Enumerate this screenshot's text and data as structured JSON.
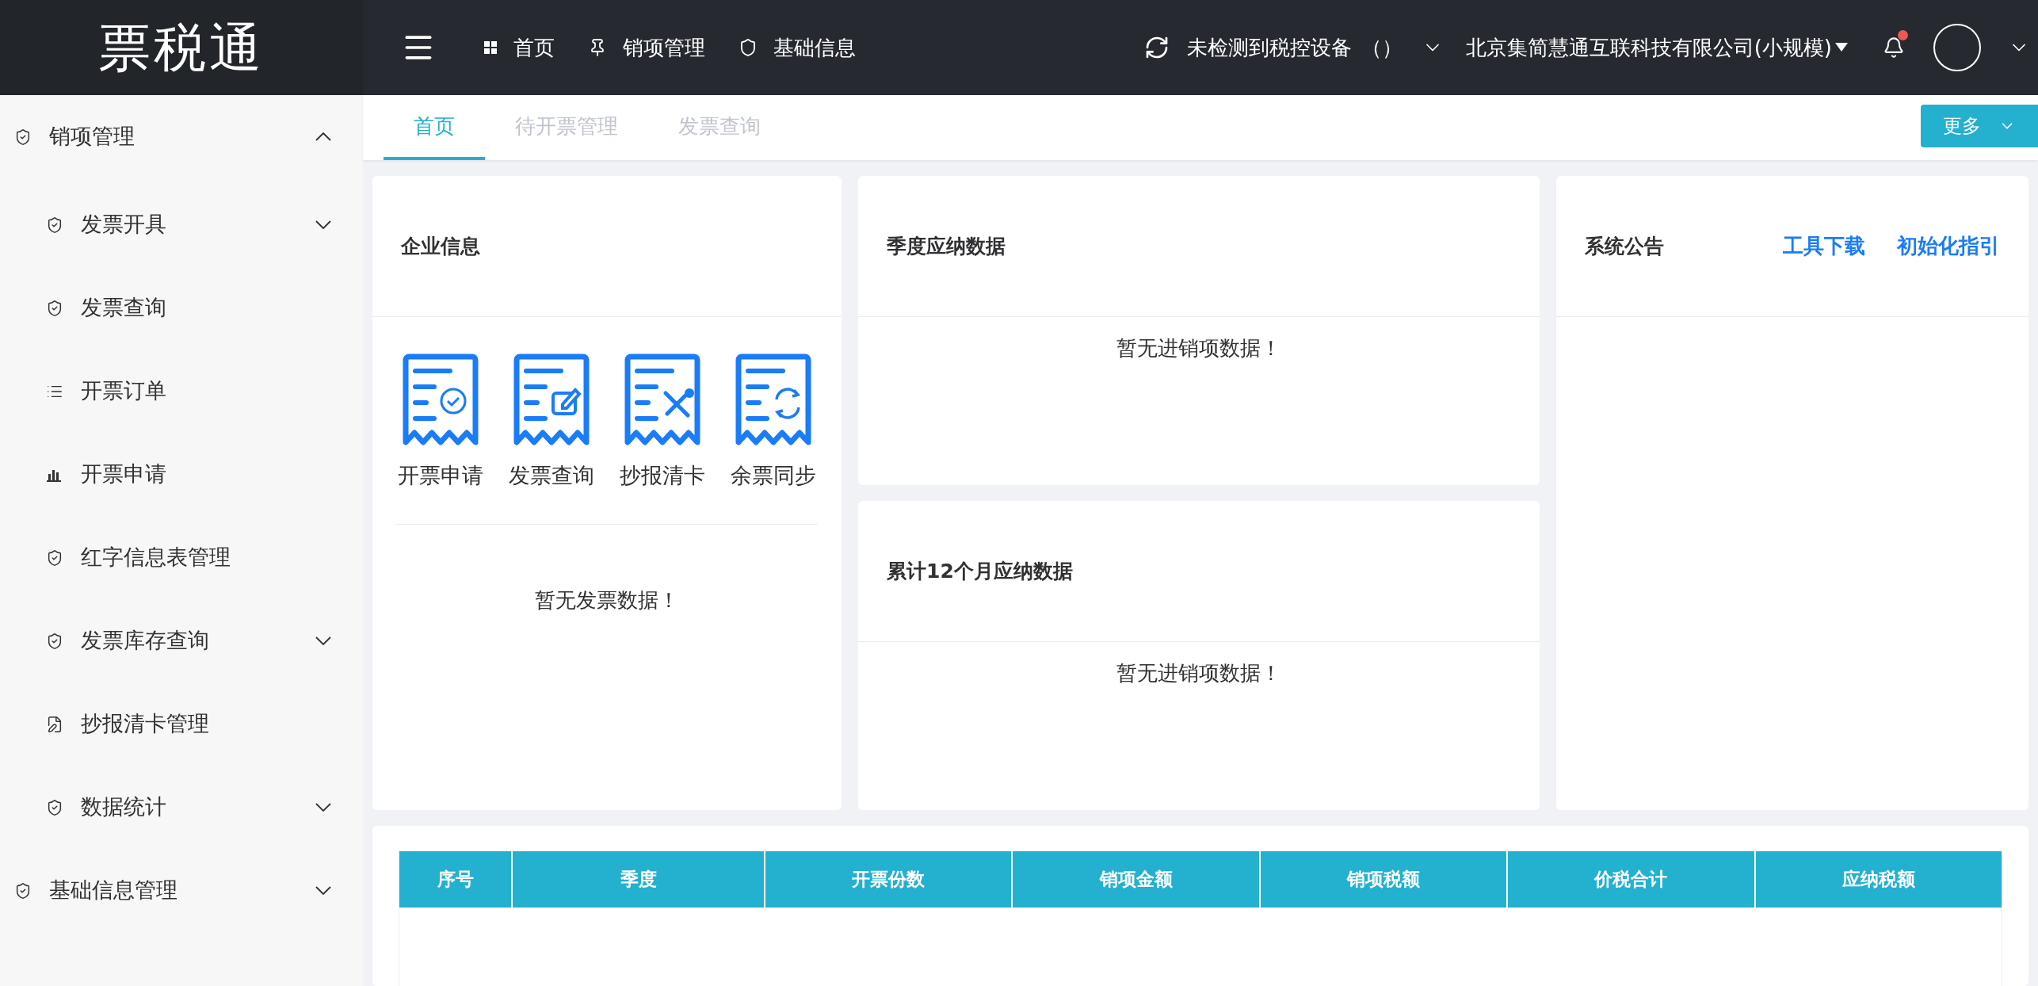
{
  "brand": {
    "logo": "票税通"
  },
  "top_nav": [
    {
      "label": "首页",
      "kind": "grid"
    },
    {
      "label": "销项管理",
      "kind": "pin"
    },
    {
      "label": "基础信息",
      "kind": "shield"
    }
  ],
  "device_status": {
    "label": "未检测到税控设备",
    "value": "（）"
  },
  "company": {
    "name": "北京集简慧通互联科技有限公司(小规模)"
  },
  "notifications": {
    "unread": true
  },
  "sidebar": {
    "items": [
      {
        "label": "销项管理",
        "kind": "shield",
        "expanded": true,
        "children": [
          {
            "label": "发票开具",
            "kind": "shield",
            "expanded": false
          },
          {
            "label": "发票查询",
            "kind": "shield"
          },
          {
            "label": "开票订单",
            "kind": "list"
          },
          {
            "label": "开票申请",
            "kind": "chart"
          },
          {
            "label": "红字信息表管理",
            "kind": "shield"
          },
          {
            "label": "发票库存查询",
            "kind": "shield",
            "expanded": false
          },
          {
            "label": "抄报清卡管理",
            "kind": "edit"
          },
          {
            "label": "数据统计",
            "kind": "shield",
            "expanded": false
          }
        ]
      },
      {
        "label": "基础信息管理",
        "kind": "shield",
        "expanded": false
      }
    ]
  },
  "tabs": [
    {
      "label": "首页",
      "selected": true
    },
    {
      "label": "待开票管理",
      "selected": false
    },
    {
      "label": "发票查询",
      "selected": false
    }
  ],
  "more_button": {
    "label": "更多"
  },
  "enterprise_card": {
    "title": "企业信息",
    "actions": [
      {
        "label": "开票申请",
        "kind": "check"
      },
      {
        "label": "发票查询",
        "kind": "edit"
      },
      {
        "label": "抄报清卡",
        "kind": "tools"
      },
      {
        "label": "余票同步",
        "kind": "sync"
      }
    ],
    "empty_text": "暂无发票数据！"
  },
  "quarter_card": {
    "title": "季度应纳数据",
    "empty_text": "暂无进销项数据！"
  },
  "twelve_month_card": {
    "title": "累计12个月应纳数据",
    "empty_text": "暂无进销项数据！"
  },
  "notice_card": {
    "title": "系统公告",
    "links": [
      "工具下载",
      "初始化指引"
    ]
  },
  "table": {
    "columns": [
      "序号",
      "季度",
      "开票份数",
      "销项金额",
      "销项税额",
      "价税合计",
      "应纳税额"
    ]
  }
}
